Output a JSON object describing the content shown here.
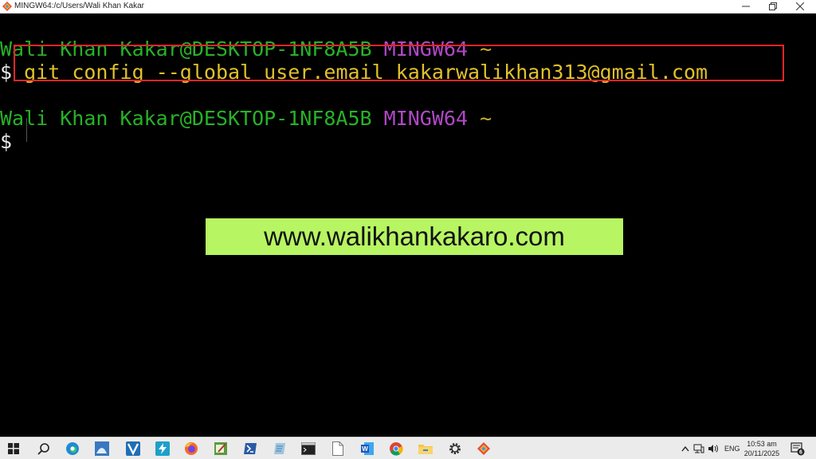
{
  "window": {
    "title": "MINGW64:/c/Users/Wali Khan Kakar"
  },
  "terminal": {
    "prompt1": {
      "user_host": "Wali Khan Kakar@DESKTOP-1NF8A5B",
      "env": "MINGW64",
      "path": "~"
    },
    "command": {
      "symbol": "$",
      "text": "git config --global user.email kakarwalikhan313@gmail.com"
    },
    "prompt2": {
      "user_host": "Wali Khan Kakar@DESKTOP-1NF8A5B",
      "env": "MINGW64",
      "path": "~"
    },
    "prompt_symbol": "$"
  },
  "banner": {
    "text": "www.walikhankakaro.com"
  },
  "taskbar": {
    "language": "ENG",
    "time": "10:53 am",
    "date": "20/11/2025",
    "notification_count": "6"
  },
  "colors": {
    "user": "#27b227",
    "env": "#b048c6",
    "command": "#e0c12a",
    "highlight_border": "#e8262b",
    "banner_bg": "#b7f562"
  }
}
